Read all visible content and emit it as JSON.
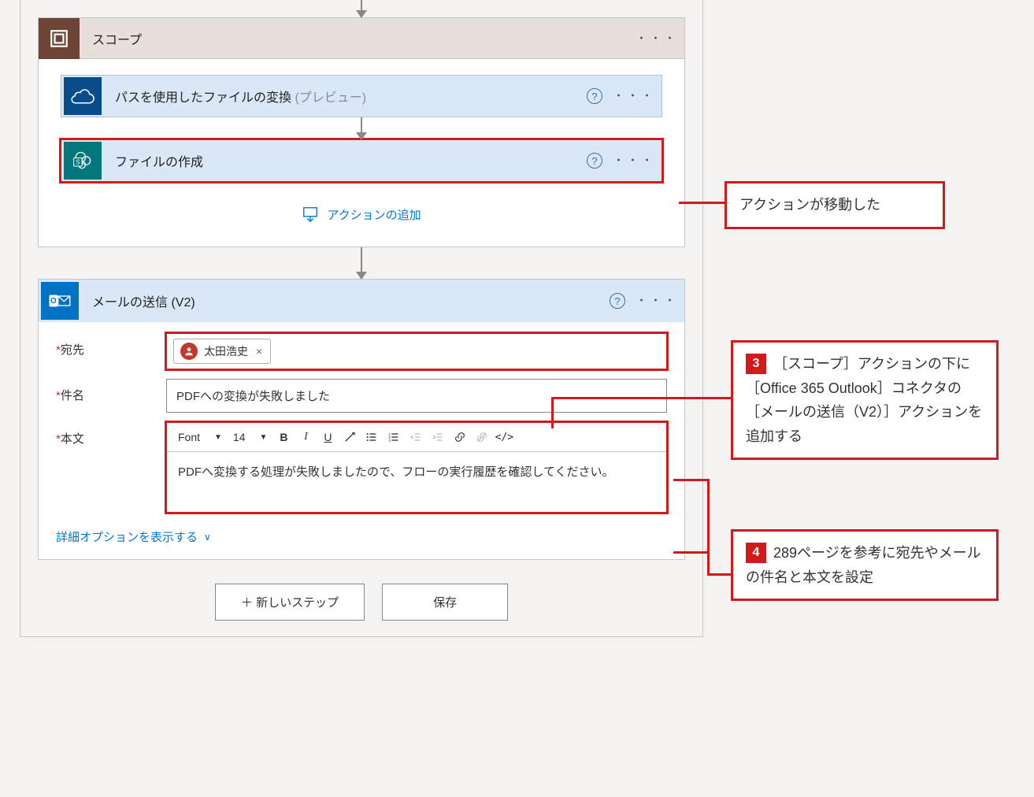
{
  "scope": {
    "title": "スコープ",
    "actions": {
      "convert": {
        "title": "パスを使用したファイルの変換",
        "preview": " (プレビュー)"
      },
      "create": {
        "title": "ファイルの作成"
      }
    },
    "add_action": "アクションの追加"
  },
  "email": {
    "title": "メールの送信 (V2)",
    "labels": {
      "to": "宛先",
      "subject": "件名",
      "body": "本文"
    },
    "to_person": "太田浩史",
    "subject_value": "PDFへの変換が失敗しました",
    "body_value": "PDFへ変換する処理が失敗しましたので、フローの実行履歴を確認してください。",
    "toolbar": {
      "font": "Font",
      "size": "14"
    },
    "advanced": "詳細オプションを表示する"
  },
  "footer": {
    "new_step": "＋ 新しいステップ",
    "save": "保存"
  },
  "callouts": {
    "moved": "アクションが移動した",
    "step3": "［スコープ］アクションの下に［Office 365 Outlook］コネクタの［メールの送信（V2）］アクションを追加する",
    "step4": "289ページを参考に宛先やメールの件名と本文を設定"
  }
}
